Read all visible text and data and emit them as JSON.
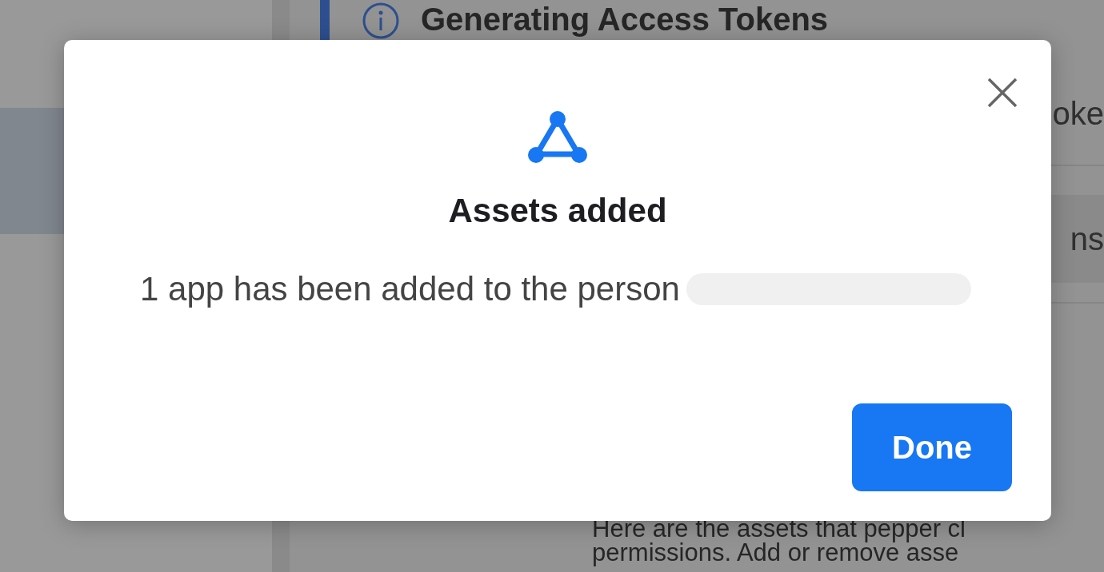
{
  "background": {
    "header": {
      "title": "Generating Access Tokens"
    },
    "rows": [
      {
        "text": "oke"
      },
      {
        "text": "ns"
      }
    ],
    "paragraph": [
      "Here are the assets that pepper cl",
      "permissions. Add or remove asse"
    ]
  },
  "dialog": {
    "title": "Assets added",
    "message": "1 app has been added to the person",
    "redacted": true,
    "button": "Done"
  }
}
